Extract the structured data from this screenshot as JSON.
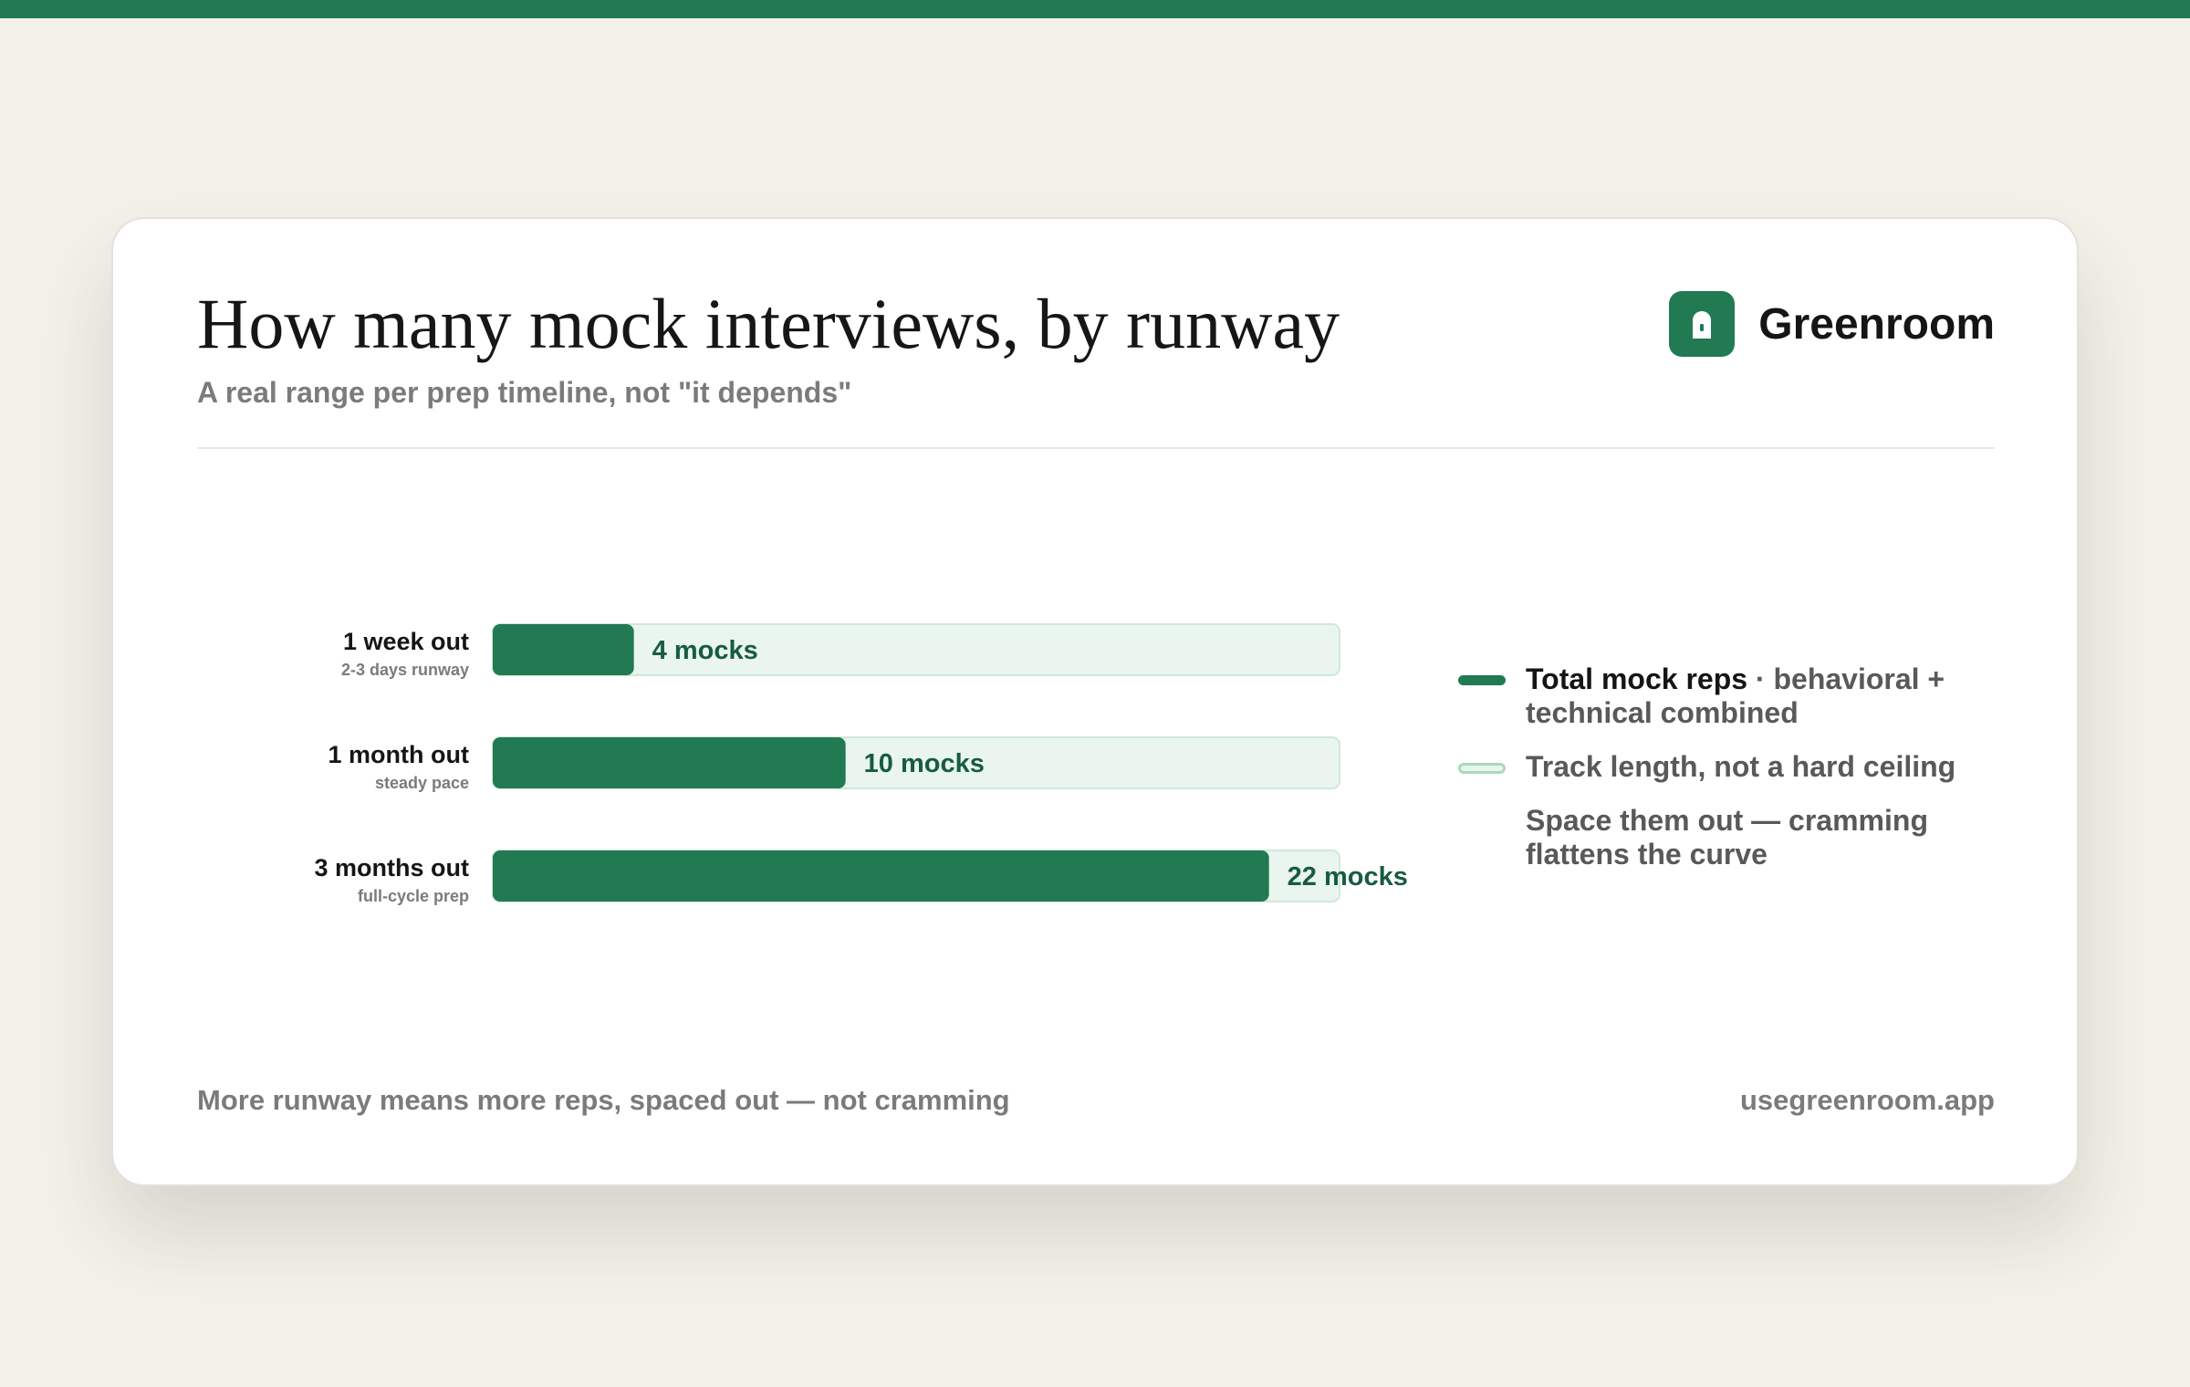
{
  "colors": {
    "accent": "#217a52",
    "track_fill": "#e9f5ee",
    "track_border": "#a8d8bd",
    "value_text": "#175c3e",
    "page_background": "#f3f1ea"
  },
  "card": {
    "title": "How many mock interviews, by runway",
    "subtitle": "A real range per prep timeline, not \"it depends\"",
    "brand": {
      "icon": "lock-icon",
      "name": "Greenroom"
    },
    "footer_left": "More runway means more reps, spaced out — not cramming",
    "footer_right": "usegreenroom.app"
  },
  "chart_data": {
    "type": "bar",
    "orientation": "horizontal",
    "title": "How many mock interviews, by runway",
    "subtitle": "A real range per prep timeline, not \"it depends\"",
    "categories": [
      "1 week out",
      "1 month out",
      "3 months out"
    ],
    "category_notes": [
      "2-3 days runway",
      "steady pace",
      "full-cycle prep"
    ],
    "values": [
      4,
      10,
      22
    ],
    "value_labels": [
      "4 mocks",
      "10 mocks",
      "22 mocks"
    ],
    "xlim": [
      0,
      24
    ],
    "grid": false,
    "legend_position": "right",
    "legend": [
      {
        "name": "Total mock reps",
        "detail": " · behavioral + technical combined",
        "style": "solid"
      },
      {
        "name": "Track length, not a hard ceiling",
        "style": "track"
      },
      {
        "name": "Space them out — cramming flattens the curve",
        "style": "none"
      }
    ]
  }
}
